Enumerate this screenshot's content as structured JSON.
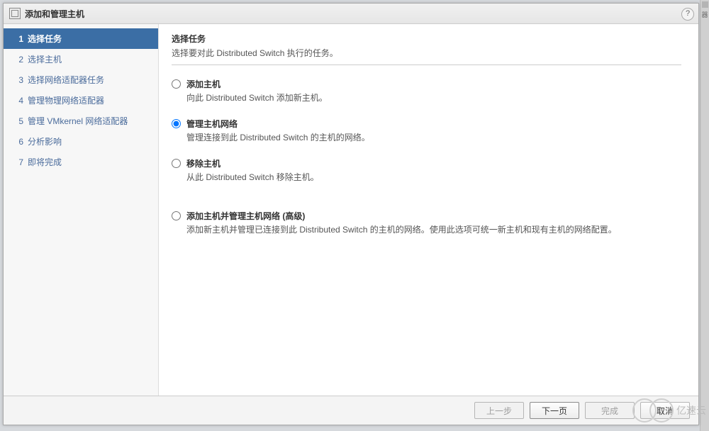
{
  "window": {
    "title": "添加和管理主机"
  },
  "steps": [
    {
      "num": "1",
      "label": "选择任务",
      "active": true
    },
    {
      "num": "2",
      "label": "选择主机"
    },
    {
      "num": "3",
      "label": "选择网络适配器任务"
    },
    {
      "num": "4",
      "label": "管理物理网络适配器"
    },
    {
      "num": "5",
      "label": "管理 VMkernel 网络适配器"
    },
    {
      "num": "6",
      "label": "分析影响"
    },
    {
      "num": "7",
      "label": "即将完成"
    }
  ],
  "task": {
    "title": "选择任务",
    "subtitle": "选择要对此 Distributed Switch 执行的任务。"
  },
  "options": [
    {
      "key": "add",
      "label": "添加主机",
      "desc": "向此 Distributed Switch 添加新主机。",
      "checked": false
    },
    {
      "key": "manage",
      "label": "管理主机网络",
      "desc": "管理连接到此 Distributed Switch 的主机的网络。",
      "checked": true
    },
    {
      "key": "remove",
      "label": "移除主机",
      "desc": "从此 Distributed Switch 移除主机。",
      "checked": false
    },
    {
      "key": "advanced",
      "label": "添加主机并管理主机网络 (高级)",
      "desc": "添加新主机并管理已连接到此 Distributed Switch 的主机的网络。使用此选项可统一新主机和现有主机的网络配置。",
      "checked": false
    }
  ],
  "buttons": {
    "back": "上一步",
    "next": "下一页",
    "finish": "完成",
    "cancel": "取消"
  },
  "watermark": "亿速云",
  "sidestrip": "器"
}
